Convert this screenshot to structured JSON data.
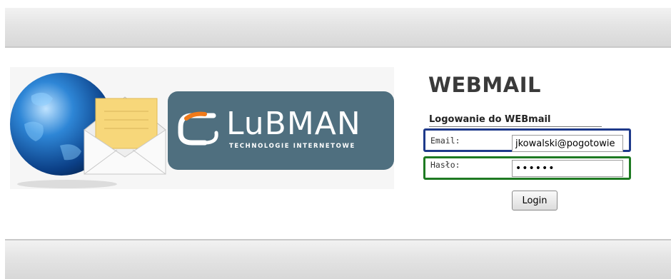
{
  "header": {},
  "banner": {
    "logo_name": "LuBMAN",
    "logo_tagline": "TECHNOLOGIE INTERNETOWE"
  },
  "login": {
    "title": "WEBMAIL",
    "subtitle": "Logowanie do WEBmail",
    "email_label": "Email:",
    "email_value": "jkowalski@pogotowie",
    "password_label": "Hasło:",
    "password_value": "••••••",
    "login_button": "Login"
  },
  "colors": {
    "email_highlight": "#1e3a8a",
    "password_highlight": "#1e7a22",
    "logo_background": "#4f6f7f",
    "logo_accent": "#f07a1a"
  },
  "icons": [
    "globe-icon",
    "envelope-icon",
    "lubman-logo-mark"
  ]
}
